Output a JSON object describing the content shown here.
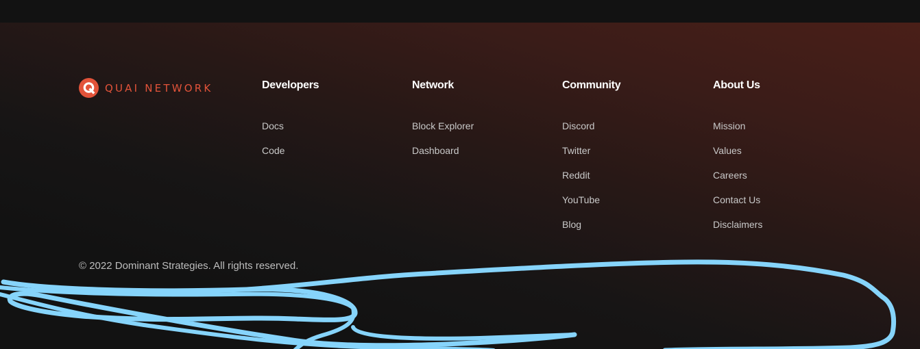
{
  "brand": {
    "name": "QUAI NETWORK",
    "logo_icon": "quai-logo-icon",
    "accent_color": "#e2533a"
  },
  "columns": [
    {
      "title": "Developers",
      "links": [
        "Docs",
        "Code"
      ]
    },
    {
      "title": "Network",
      "links": [
        "Block Explorer",
        "Dashboard"
      ]
    },
    {
      "title": "Community",
      "links": [
        "Discord",
        "Twitter",
        "Reddit",
        "YouTube",
        "Blog"
      ]
    },
    {
      "title": "About Us",
      "links": [
        "Mission",
        "Values",
        "Careers",
        "Contact Us",
        "Disclaimers"
      ]
    }
  ],
  "copyright": "© 2022 Dominant Strategies. All rights reserved.",
  "annotation": {
    "type": "hand-drawn-scribble",
    "color": "#86d4fb"
  }
}
